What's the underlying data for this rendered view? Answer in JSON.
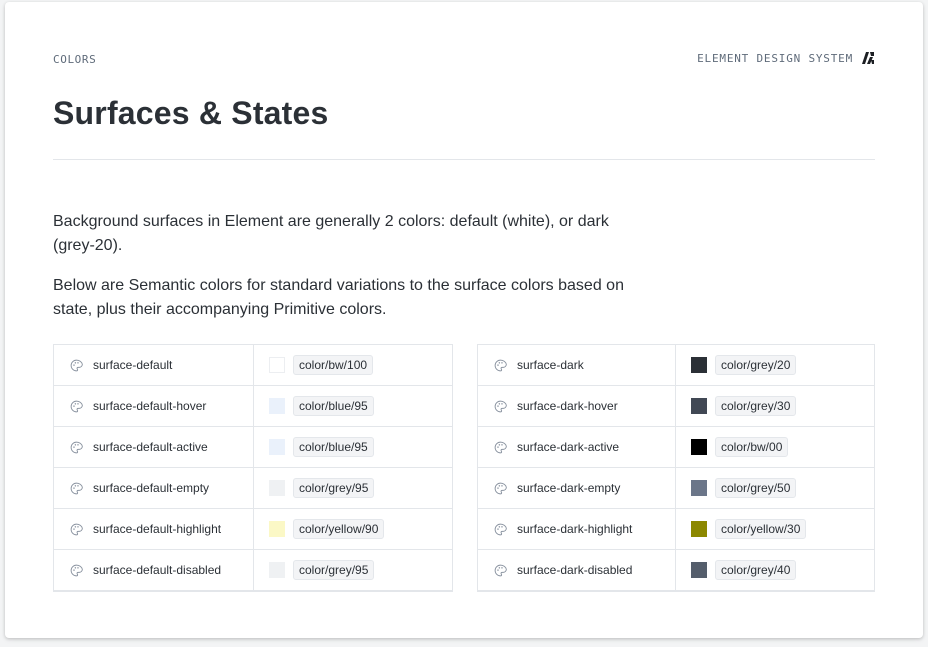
{
  "header": {
    "eyebrow": "COLORS",
    "brand": "ELEMENT DESIGN SYSTEM",
    "title": "Surfaces & States"
  },
  "intro": {
    "p1": "Background surfaces in Element are generally 2 colors: default (white), or dark (grey-20).",
    "p2": "Below are Semantic colors for standard variations to the surface colors based on state, plus their accompanying Primitive colors."
  },
  "tables": {
    "default": [
      {
        "name": "surface-default",
        "primitive": "color/bw/100",
        "swatch": "#ffffff",
        "icon": "palette-icon"
      },
      {
        "name": "surface-default-hover",
        "primitive": "color/blue/95",
        "swatch": "#eaf1fb",
        "icon": "palette-icon"
      },
      {
        "name": "surface-default-active",
        "primitive": "color/blue/95",
        "swatch": "#eaf1fb",
        "icon": "palette-icon"
      },
      {
        "name": "surface-default-empty",
        "primitive": "color/grey/95",
        "swatch": "#eff1f3",
        "icon": "palette-icon"
      },
      {
        "name": "surface-default-highlight",
        "primitive": "color/yellow/90",
        "swatch": "#fbf8c6",
        "icon": "palette-icon"
      },
      {
        "name": "surface-default-disabled",
        "primitive": "color/grey/95",
        "swatch": "#eff1f3",
        "icon": "palette-icon"
      }
    ],
    "dark": [
      {
        "name": "surface-dark",
        "primitive": "color/grey/20",
        "swatch": "#2b3036",
        "icon": "palette-icon"
      },
      {
        "name": "surface-dark-hover",
        "primitive": "color/grey/30",
        "swatch": "#414854",
        "icon": "palette-icon"
      },
      {
        "name": "surface-dark-active",
        "primitive": "color/bw/00",
        "swatch": "#000000",
        "icon": "palette-icon"
      },
      {
        "name": "surface-dark-empty",
        "primitive": "color/grey/50",
        "swatch": "#6b7689",
        "icon": "palette-icon"
      },
      {
        "name": "surface-dark-highlight",
        "primitive": "color/yellow/30",
        "swatch": "#8c8800",
        "icon": "palette-icon"
      },
      {
        "name": "surface-dark-disabled",
        "primitive": "color/grey/40",
        "swatch": "#555e6c",
        "icon": "palette-icon"
      }
    ]
  }
}
